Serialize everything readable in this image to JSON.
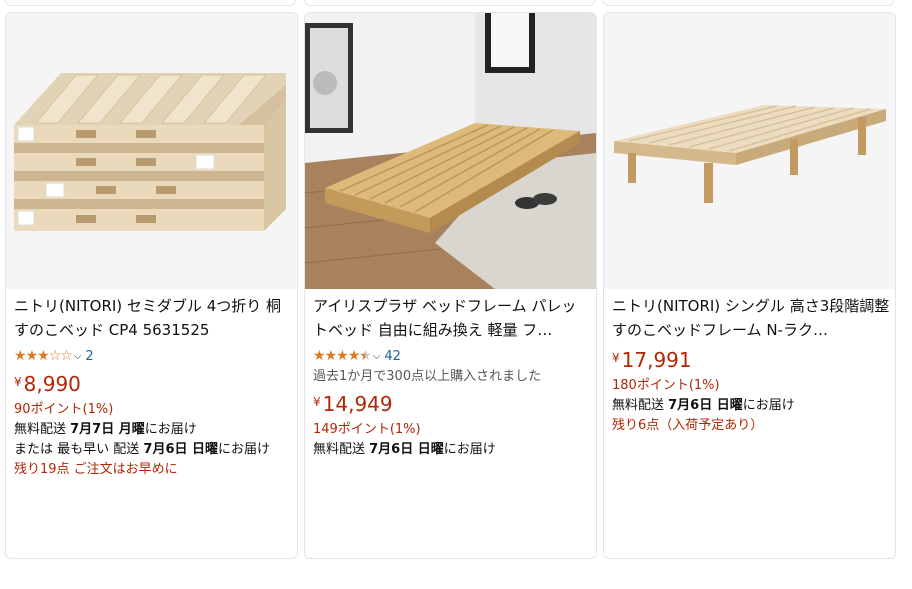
{
  "products": [
    {
      "title": "ニトリ(NITORI) セミダブル 4つ折り 桐すのこベッド CP4 5631525",
      "rating_value": 3,
      "rating_count": "2",
      "price_currency": "¥",
      "price": "8,990",
      "points": "90ポイント(1%)",
      "delivery_1_prefix": "無料配送 ",
      "delivery_1_date": "7月7日 月曜",
      "delivery_1_suffix": "にお届け",
      "delivery_2_prefix": "または 最も早い 配送 ",
      "delivery_2_date": "7月6日 日曜",
      "delivery_2_suffix": "にお届け",
      "stock": "残り19点 ご注文はお早めに"
    },
    {
      "title": "アイリスプラザ ベッドフレーム パレットベッド 自由に組み換え 軽量 フ…",
      "rating_value": 4.5,
      "rating_count": "42",
      "bought": "過去1か月で300点以上購入されました",
      "price_currency": "¥",
      "price": "14,949",
      "points": "149ポイント(1%)",
      "delivery_1_prefix": "無料配送 ",
      "delivery_1_date": "7月6日 日曜",
      "delivery_1_suffix": "にお届け"
    },
    {
      "title": "ニトリ(NITORI) シングル 高さ3段階調整すのこベッドフレーム N-ラク…",
      "price_currency": "¥",
      "price": "17,991",
      "points": "180ポイント(1%)",
      "delivery_1_prefix": "無料配送 ",
      "delivery_1_date": "7月6日 日曜",
      "delivery_1_suffix": "にお届け",
      "stock": "残り6点（入荷予定あり）"
    }
  ],
  "colors": {
    "star": "#de7921",
    "price": "#b12704",
    "link": "#2162a1"
  },
  "icons": {
    "rating_dropdown": "chevron-down-icon"
  }
}
